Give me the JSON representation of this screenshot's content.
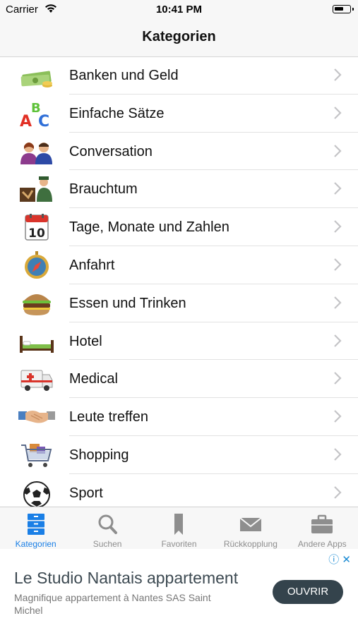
{
  "status_bar": {
    "carrier": "Carrier",
    "time": "10:41 PM"
  },
  "nav": {
    "title": "Kategorien"
  },
  "categories": [
    {
      "label": "Banken und Geld",
      "icon": "money-icon"
    },
    {
      "label": "Einfache Sätze",
      "icon": "abc-letters-icon"
    },
    {
      "label": "Conversation",
      "icon": "people-icon"
    },
    {
      "label": "Brauchtum",
      "icon": "customs-icon"
    },
    {
      "label": "Tage, Monate und Zahlen",
      "icon": "calendar-icon"
    },
    {
      "label": "Anfahrt",
      "icon": "compass-icon"
    },
    {
      "label": "Essen und Trinken",
      "icon": "burger-icon"
    },
    {
      "label": "Hotel",
      "icon": "bed-icon"
    },
    {
      "label": "Medical",
      "icon": "ambulance-icon"
    },
    {
      "label": "Leute treffen",
      "icon": "handshake-icon"
    },
    {
      "label": "Shopping",
      "icon": "shopping-cart-icon"
    },
    {
      "label": "Sport",
      "icon": "soccer-ball-icon"
    }
  ],
  "calendar_day": "10",
  "tabs": [
    {
      "label": "Kategorien",
      "icon": "list-icon",
      "active": true
    },
    {
      "label": "Suchen",
      "icon": "search-icon",
      "active": false
    },
    {
      "label": "Favoriten",
      "icon": "bookmark-icon",
      "active": false
    },
    {
      "label": "Rückkopplung",
      "icon": "mail-icon",
      "active": false
    },
    {
      "label": "Andere Apps",
      "icon": "briefcase-icon",
      "active": false
    }
  ],
  "ad": {
    "headline": "Le Studio Nantais appartement",
    "description": "Magnifique appartement à Nantes SAS Saint Michel",
    "cta": "OUVRIR",
    "adchoices": "ⓘ ✕"
  },
  "colors": {
    "accent": "#1a7fe6",
    "tab_inactive": "#8e8e8e",
    "cta_bg": "#34434c"
  }
}
